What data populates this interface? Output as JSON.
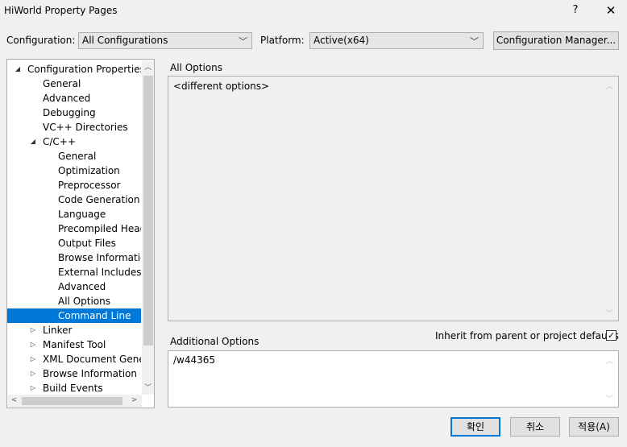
{
  "window": {
    "title": "HiWorld Property Pages",
    "help_label": "?",
    "close_label": "✕"
  },
  "toolbar": {
    "configuration_label": "Configuration:",
    "configuration_value": "All Configurations",
    "platform_label": "Platform:",
    "platform_value": "Active(x64)",
    "config_manager_label": "Configuration Manager..."
  },
  "tree": {
    "items": [
      {
        "label": "Configuration Properties",
        "expanded": true
      },
      {
        "label": "General"
      },
      {
        "label": "Advanced"
      },
      {
        "label": "Debugging"
      },
      {
        "label": "VC++ Directories"
      },
      {
        "label": "C/C++",
        "expanded": true
      },
      {
        "label": "General"
      },
      {
        "label": "Optimization"
      },
      {
        "label": "Preprocessor"
      },
      {
        "label": "Code Generation"
      },
      {
        "label": "Language"
      },
      {
        "label": "Precompiled Heade"
      },
      {
        "label": "Output Files"
      },
      {
        "label": "Browse Information"
      },
      {
        "label": "External Includes"
      },
      {
        "label": "Advanced"
      },
      {
        "label": "All Options"
      },
      {
        "label": "Command Line",
        "selected": true
      },
      {
        "label": "Linker",
        "expanded": false
      },
      {
        "label": "Manifest Tool",
        "expanded": false
      },
      {
        "label": "XML Document Genera",
        "expanded": false
      },
      {
        "label": "Browse Information",
        "expanded": false
      },
      {
        "label": "Build Events",
        "expanded": false
      }
    ]
  },
  "all_options": {
    "label": "All Options",
    "value": "<different options>"
  },
  "additional_options": {
    "label": "Additional Options",
    "value": "/w44365",
    "inherit_label": "Inherit from parent or project defaults",
    "inherit_checked": true,
    "check_glyph": "✓"
  },
  "footer": {
    "ok_label": "확인",
    "cancel_label": "취소",
    "apply_label": "적용(A)"
  },
  "colors": {
    "selection": "#0078d7",
    "background": "#f0f0f0"
  }
}
